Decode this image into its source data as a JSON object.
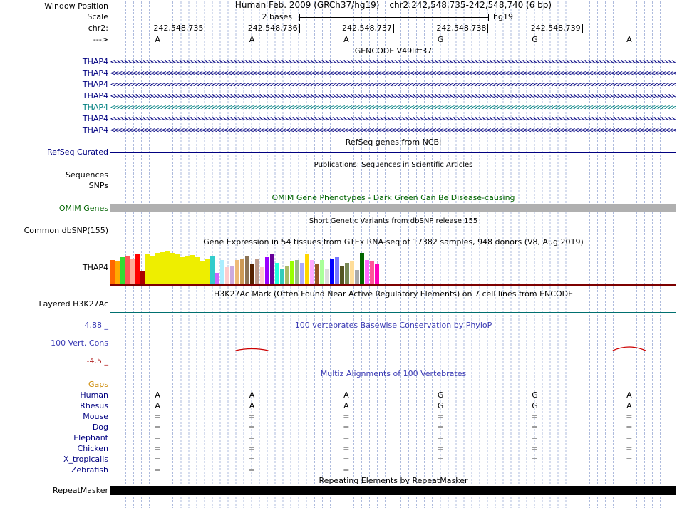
{
  "header": {
    "window_position_label": "Window Position",
    "assembly_title": "Human Feb. 2009 (GRCh37/hg19)",
    "position_title": "chr2:242,548,735-242,548,740 (6 bp)",
    "scale_label": "Scale",
    "scale_value": "2 bases",
    "assembly_short": "hg19",
    "chrom_label": "chr2:",
    "strand_arrow": "--->",
    "ruler_ticks": [
      "242,548,735",
      "242,548,736",
      "242,548,737",
      "242,548,738",
      "242,548,739"
    ],
    "bases": [
      "A",
      "A",
      "A",
      "G",
      "G",
      "A"
    ]
  },
  "gencode": {
    "title": "GENCODE V49lift37",
    "arrow_char": "<",
    "transcripts": [
      {
        "label": "THAP4",
        "color": "#000080"
      },
      {
        "label": "THAP4",
        "color": "#000080"
      },
      {
        "label": "THAP4",
        "color": "#000080"
      },
      {
        "label": "THAP4",
        "color": "#000080"
      },
      {
        "label": "THAP4",
        "color": "#008080"
      },
      {
        "label": "THAP4",
        "color": "#000080"
      },
      {
        "label": "THAP4",
        "color": "#000080"
      }
    ]
  },
  "refseq": {
    "title": "RefSeq genes from NCBI",
    "label": "RefSeq Curated",
    "color": "#000080"
  },
  "publications": {
    "title": "Publications: Sequences in Scientific Articles",
    "row_labels": [
      "Sequences",
      "SNPs"
    ]
  },
  "omim": {
    "title": "OMIM Gene Phenotypes - Dark Green Can Be Disease-causing",
    "label": "OMIM Genes",
    "title_color": "#006400",
    "bar_color": "#B0B0B0"
  },
  "dbsnp": {
    "title": "Short Genetic Variants from dbSNP release 155",
    "label": "Common dbSNP(155)"
  },
  "gtex": {
    "title": "Gene Expression in 54 tissues from GTEx RNA-seq of 17382 samples, 948 donors (V8, Aug 2019)",
    "label": "THAP4",
    "baseline_color": "#7D0000"
  },
  "h3k27ac": {
    "title": "H3K27Ac Mark (Often Found Near Active Regulatory Elements) on 7 cell lines from ENCODE",
    "label": "Layered H3K27Ac",
    "line_color": "#007070"
  },
  "phylop": {
    "title": "100 vertebrates Basewise Conservation by PhyloP",
    "label": "100 Vert. Cons",
    "max_label": "4.88 _",
    "min_label": "-4.5 _",
    "title_color": "#3A3AB4",
    "dip_color": "#CC0000",
    "dips": [
      {
        "column": 1,
        "amplitude": 5
      },
      {
        "column": 5,
        "amplitude": 10
      }
    ]
  },
  "multiz": {
    "title": "Multiz Alignments of 100 Vertebrates",
    "title_color": "#3A3AB4",
    "rows": [
      {
        "name": "Gaps",
        "label_color": "#CC8800",
        "cells": [
          "",
          "",
          "",
          "",
          "",
          ""
        ]
      },
      {
        "name": "Human",
        "label_color": "#000080",
        "cells": [
          "A",
          "A",
          "A",
          "G",
          "G",
          "A"
        ]
      },
      {
        "name": "Rhesus",
        "label_color": "#000080",
        "cells": [
          "A",
          "A",
          "A",
          "G",
          "G",
          "A"
        ]
      },
      {
        "name": "Mouse",
        "label_color": "#000080",
        "cells": [
          "=",
          "=",
          "=",
          "=",
          "=",
          "="
        ]
      },
      {
        "name": "Dog",
        "label_color": "#000080",
        "cells": [
          "=",
          "=",
          "=",
          "=",
          "=",
          "="
        ]
      },
      {
        "name": "Elephant",
        "label_color": "#000080",
        "cells": [
          "=",
          "=",
          "=",
          "=",
          "=",
          "="
        ]
      },
      {
        "name": "Chicken",
        "label_color": "#000080",
        "cells": [
          "=",
          "=",
          "=",
          "=",
          "=",
          "="
        ]
      },
      {
        "name": "X_tropicalis",
        "label_color": "#000080",
        "cells": [
          "=",
          "=",
          "=",
          "=",
          "=",
          "="
        ]
      },
      {
        "name": "Zebrafish",
        "label_color": "#000080",
        "cells": [
          "=",
          "=",
          "=",
          "",
          "",
          ""
        ]
      }
    ]
  },
  "repeatmasker": {
    "title": "Repeating Elements by RepeatMasker",
    "label": "RepeatMasker",
    "bar_color": "#000000"
  },
  "colors": {
    "guideline": "#AEBBDD",
    "track_blue": "#000080",
    "title_blue": "#3A3AB4",
    "omim_green": "#006400",
    "gtex_baseline": "#7D0000",
    "h3k27ac_teal": "#007070",
    "phylop_red": "#CC0000",
    "phylop_min_red": "#B22222"
  },
  "chart_data": {
    "type": "bar",
    "title": "Gene Expression in 54 tissues from GTEx RNA-seq of 17382 samples, 948 donors (V8, Aug 2019)",
    "gene": "THAP4",
    "n_bars": 54,
    "values": [
      34,
      32,
      38,
      40,
      36,
      42,
      18,
      42,
      40,
      44,
      46,
      47,
      44,
      43,
      38,
      40,
      41,
      38,
      33,
      35,
      40,
      16,
      34,
      24,
      26,
      34,
      36,
      40,
      28,
      36,
      24,
      38,
      42,
      30,
      22,
      26,
      32,
      34,
      30,
      42,
      34,
      28,
      34,
      22,
      36,
      38,
      26,
      30,
      32,
      20,
      44,
      34,
      32,
      28
    ],
    "colors": [
      "#FF6600",
      "#FFAA00",
      "#33DD33",
      "#FF5555",
      "#FFAA99",
      "#FF0000",
      "#AA0000",
      "#EEEE00",
      "#EEEE00",
      "#EEEE00",
      "#EEEE00",
      "#EEEE00",
      "#EEEE00",
      "#EEEE00",
      "#EEEE00",
      "#EEEE00",
      "#EEEE00",
      "#EEEE00",
      "#EEEE00",
      "#EEEE00",
      "#33CCCC",
      "#CC66FF",
      "#AAEEFF",
      "#FFCCCC",
      "#CCAADD",
      "#EEBB77",
      "#CC9955",
      "#8B7355",
      "#552200",
      "#BB9988",
      "#FFCCCC",
      "#9900FF",
      "#660099",
      "#22FFDD",
      "#33CCBB",
      "#AABB66",
      "#99FF00",
      "#99BB88",
      "#AAAAFF",
      "#FFD700",
      "#FFAAFF",
      "#995522",
      "#AAFF99",
      "#DDDDDD",
      "#0000FF",
      "#7777FF",
      "#555522",
      "#778855",
      "#FFDD99",
      "#AAAAAA",
      "#006600",
      "#FF66FF",
      "#FF5599",
      "#FF00BB"
    ]
  }
}
